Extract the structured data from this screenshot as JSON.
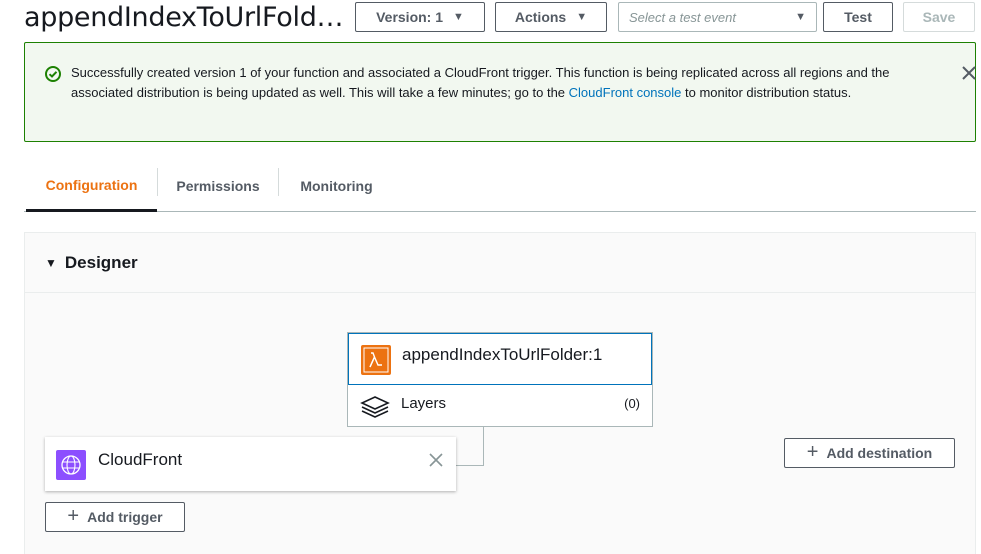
{
  "header": {
    "title": "appendIndexToUrlFold…",
    "version_label": "Version: 1",
    "actions_label": "Actions",
    "test_event_placeholder": "Select a test event",
    "test_label": "Test",
    "save_label": "Save"
  },
  "flash": {
    "message_before_link": "Successfully created version 1 of your function and associated a CloudFront trigger. This function is being replicated across all regions and the associated distribution is being updated as well. This will take a few minutes; go to the ",
    "link_text": "CloudFront console",
    "message_after_link": " to monitor distribution status."
  },
  "tabs": [
    {
      "label": "Configuration",
      "active": true
    },
    {
      "label": "Permissions",
      "active": false
    },
    {
      "label": "Monitoring",
      "active": false
    }
  ],
  "designer": {
    "heading": "Designer",
    "function_name": "appendIndexToUrlFolder:1",
    "layers_label": "Layers",
    "layers_count": "(0)",
    "trigger_name": "CloudFront",
    "add_trigger_label": "Add trigger",
    "add_destination_label": "Add destination"
  },
  "colors": {
    "accent": "#ec7211",
    "link": "#0073bb",
    "success": "#1d8102",
    "lambda": "#ec7211",
    "cloudfront": "#8c4fff"
  }
}
